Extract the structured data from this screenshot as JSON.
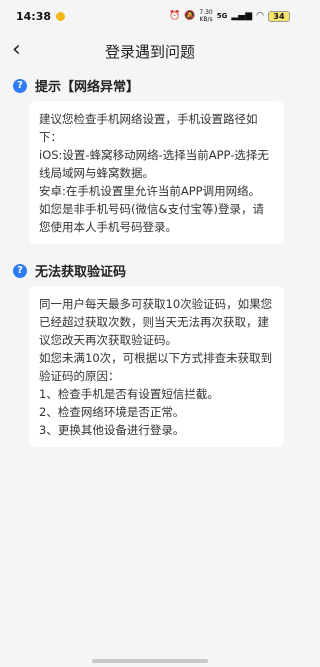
{
  "status": {
    "time": "14:38",
    "speed_value": "7.30",
    "speed_unit": "KB/s",
    "network": "5G",
    "battery": "34"
  },
  "header": {
    "title": "登录遇到问题"
  },
  "sections": [
    {
      "title": "提示【网络异常】",
      "lines": [
        "建议您检查手机网络设置，手机设置路径如下：",
        "iOS:设置-蜂窝移动网络-选择当前APP-选择无线局域网与蜂窝数据。",
        "安卓:在手机设置里允许当前APP调用网络。",
        "如您是非手机号码(微信&支付宝等)登录，请您使用本人手机号码登录。"
      ]
    },
    {
      "title": "无法获取验证码",
      "lines": [
        "同一用户每天最多可获取10次验证码，如果您已经超过获取次数，则当天无法再次获取，建议您改天再次获取验证码。",
        "如您未满10次，可根据以下方式排查未获取到验证码的原因：",
        "1、检查手机是否有设置短信拦截。",
        "2、检查网络环境是否正常。",
        "3、更换其他设备进行登录。"
      ]
    }
  ]
}
